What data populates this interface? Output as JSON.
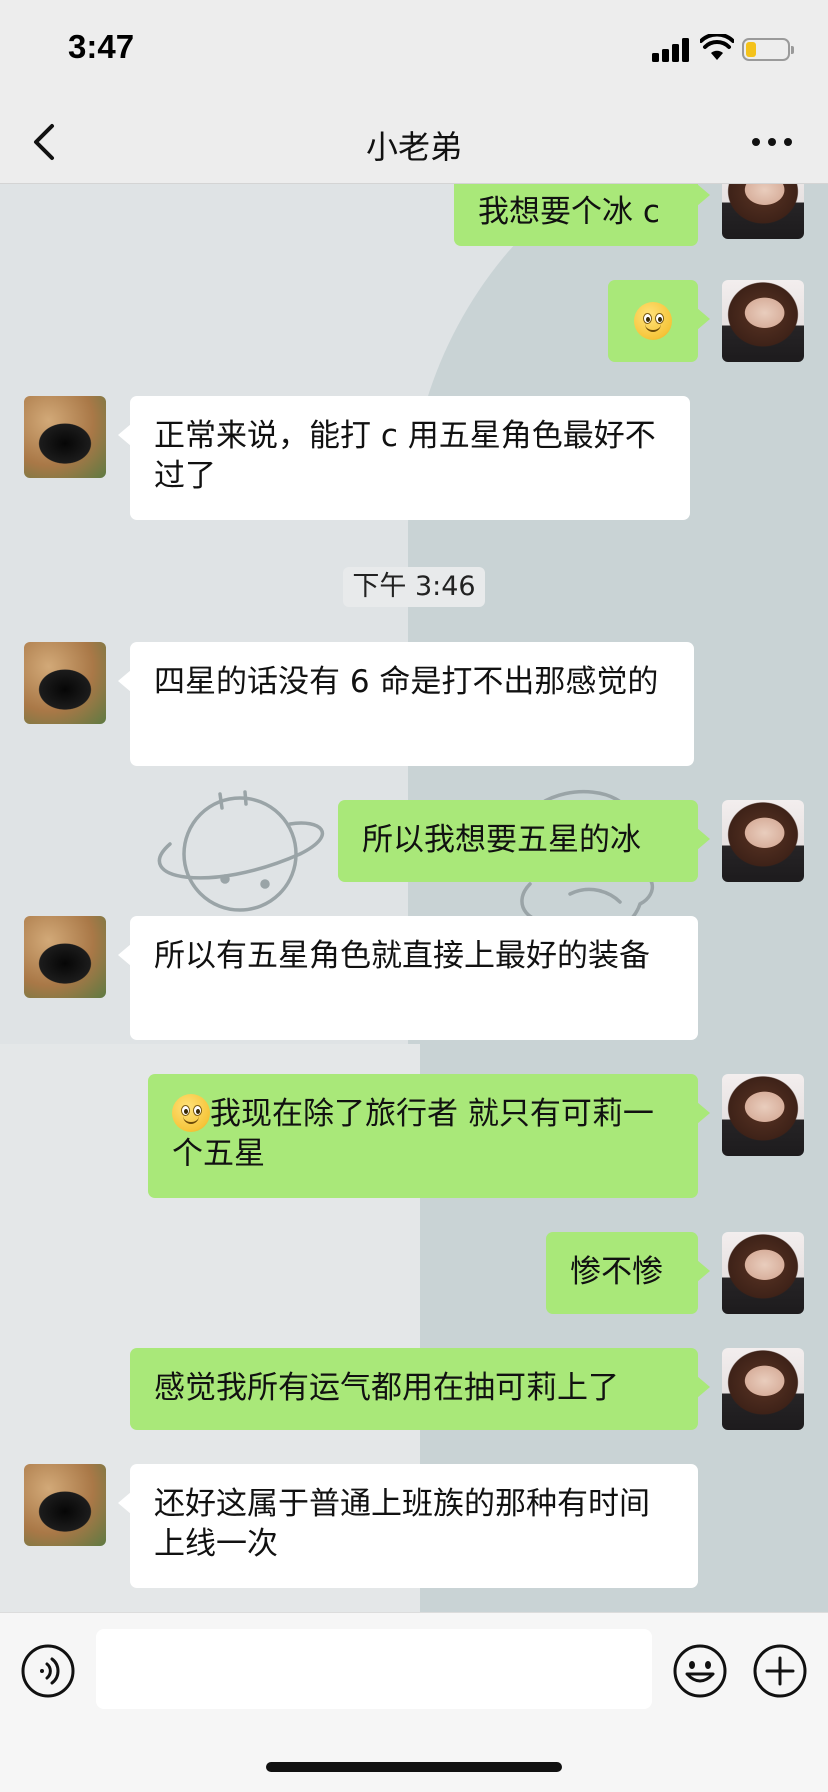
{
  "status_bar": {
    "time": "3:47"
  },
  "nav": {
    "title": "小老弟"
  },
  "messages": [
    {
      "side": "out",
      "text": "我想要个冰 c"
    },
    {
      "side": "out",
      "emoji": "smile-emoji",
      "text": ""
    },
    {
      "side": "in",
      "text": "正常来说，能打 c 用五星角色最好不过了"
    },
    {
      "type": "timestamp",
      "text": "下午 3:46"
    },
    {
      "side": "in",
      "text": "四星的话没有 6 命是打不出那感觉的"
    },
    {
      "side": "out",
      "text": "所以我想要五星的冰"
    },
    {
      "side": "in",
      "text": "所以有五星角色就直接上最好的装备"
    },
    {
      "side": "out",
      "emoji": "smile-emoji",
      "text": "我现在除了旅行者 就只有可莉一个五星"
    },
    {
      "side": "out",
      "text": "惨不惨"
    },
    {
      "side": "out",
      "text": "感觉我所有运气都用在抽可莉上了"
    },
    {
      "side": "in",
      "text": "还好这属于普通上班族的那种有时间上线一次"
    }
  ],
  "input": {
    "value": ""
  },
  "colors": {
    "outgoing_bubble": "#a9e879",
    "incoming_bubble": "#ffffff",
    "header_bg": "#ededed",
    "battery_fill": "#f4c21b"
  },
  "icons": [
    "back-icon",
    "more-icon",
    "voice-icon",
    "emoji-icon",
    "plus-icon",
    "signal-icon",
    "wifi-icon",
    "battery-icon"
  ]
}
